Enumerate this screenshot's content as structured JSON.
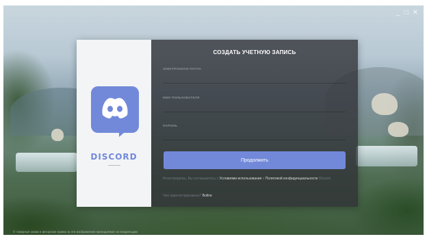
{
  "window": {
    "controls": {
      "minimize": "_",
      "maximize": "□",
      "close": "✕"
    }
  },
  "brand": {
    "wordmark": "DISCORD",
    "logo_color": "#7289da"
  },
  "form": {
    "title": "СОЗДАТЬ УЧЕТНУЮ ЗАПИСЬ",
    "email_label": "ЭЛЕКТРОННАЯ ПОЧТА",
    "email_value": "",
    "username_label": "ИМЯ ПОЛЬЗОВАТЕЛЯ",
    "username_value": "",
    "password_label": "ПАРОЛЬ",
    "password_value": "",
    "continue_label": "Продолжить"
  },
  "terms": {
    "prefix": "Регистрируясь, Вы соглашаетесь с ",
    "tos_link": "Условиями использования",
    "middle": " и ",
    "privacy_link": "Политикой конфиденциальности",
    "suffix": " Discord"
  },
  "login": {
    "prompt": "Уже зарегистрированы? ",
    "link": "Войти"
  },
  "footer": {
    "text": "© товарные знаки и авторские права на эти изображения принадлежат их владельцам"
  },
  "colors": {
    "accent": "#7289da",
    "panel": "#2f3136",
    "left_panel": "#f3f4f6"
  }
}
